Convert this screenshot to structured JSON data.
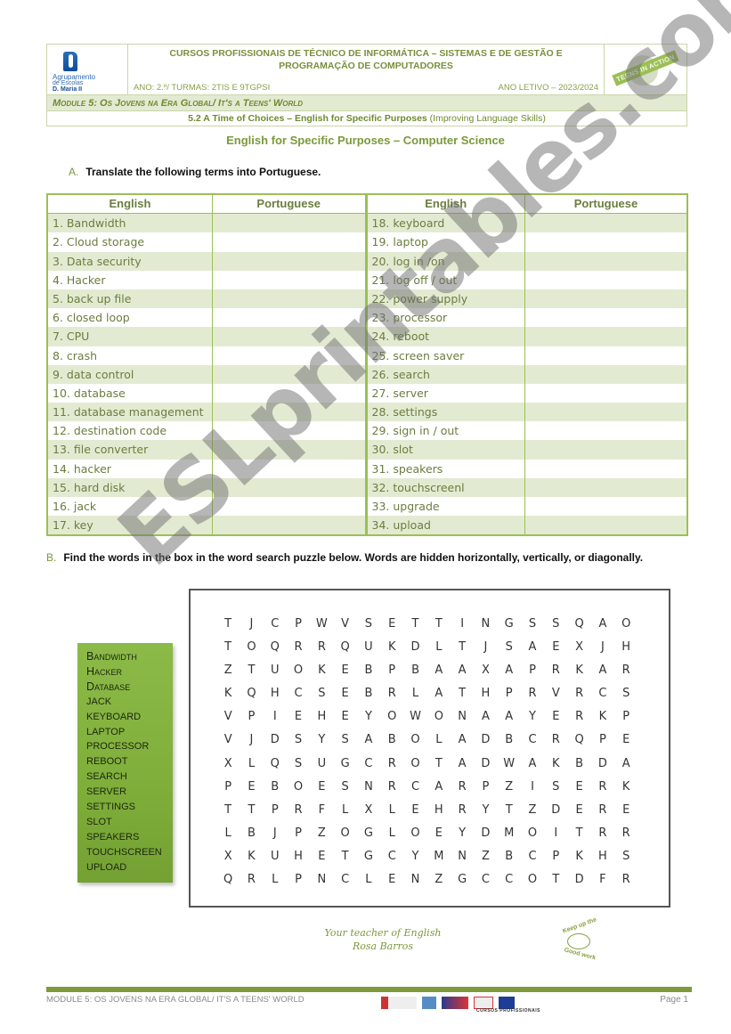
{
  "header": {
    "school_logo": {
      "line1": "Agrupamento",
      "line2": "de Escolas",
      "line3": "D. Maria II"
    },
    "course_title": "CURSOS PROFISSIONAIS DE TÉCNICO DE INFORMÁTICA – SISTEMAS E DE GESTÃO E PROGRAMAÇÃO DE COMPUTADORES",
    "year_classes": "ANO: 2.º/ TURMAS: 2TIS E 9TGPSI",
    "school_year": "ANO LETIVO – 2023/2024",
    "badge_text": "TEENS IN ACTION",
    "module": "Module 5: Os Jovens na Era Global/ It's a Teens' World",
    "subtitle_bold": "5.2 A Time of Choices – English for Specific Purposes",
    "subtitle_rest": " (Improving Language Skills)"
  },
  "doc_title": "English for Specific Purposes – Computer Science",
  "section_a": {
    "letter": "A.",
    "instruction": "Translate the following terms into Portuguese.",
    "columns": [
      "English",
      "Portuguese",
      "English",
      "Portuguese"
    ],
    "left_terms": [
      "1. Bandwidth",
      "2. Cloud storage",
      "3. Data security",
      "4. Hacker",
      "5. back up file",
      "6. closed loop",
      "7. CPU",
      "8. crash",
      "9. data control",
      "10. database",
      "11. database management",
      "12. destination code",
      "13. file converter",
      "14. hacker",
      "15. hard disk",
      "16. jack",
      "17. key"
    ],
    "right_terms": [
      "18. keyboard",
      "19. laptop",
      "20. log in /on",
      "21. log off / out",
      "22. power supply",
      "23. processor",
      "24. reboot",
      "25. screen saver",
      "26. search",
      "27. server",
      "28. settings",
      "29. sign in / out",
      "30. slot",
      "31. speakers",
      "32. touchscreenl",
      "33. upgrade",
      "34. upload"
    ]
  },
  "section_b": {
    "letter": "B.",
    "instruction": "Find the words in the box in the word search puzzle below. Words are hidden horizontally, vertically, or diagonally.",
    "word_list": [
      "Bandwidth",
      "Hacker",
      "Database",
      "JACK",
      "KEYBOARD",
      "LAPTOP",
      "PROCESSOR",
      "REBOOT",
      "SEARCH",
      "SERVER",
      "SETTINGS",
      "SLOT",
      "SPEAKERS",
      "TOUCHSCREEN",
      "UPLOAD"
    ],
    "grid": [
      "TJCPWVSETTINGSSQAO",
      "TOQRRQUKDLTJSAEXJH",
      "ZTUOKEBPBAAXAPRKAR",
      "KQHCSEBRLATHPRVRCS",
      "VPIEHEYOWONAAYERKP",
      "VJDSYSABOLADBCRQPE",
      "XLQSUGCROTADWAKBDA",
      "PEBOESNRCARPZISERK",
      "TTPRFLXLEHRYTZDERE",
      "LBJPZOGLOEYDMOITRR",
      "XKUHETGCYMNZBCPKHS",
      "QRLPNCLENZGCCOTDFR"
    ]
  },
  "signature": {
    "line1": "Your teacher of English",
    "line2": "Rosa Barros"
  },
  "stamp": {
    "top": "Keep up the",
    "bottom": "Good work"
  },
  "footer": {
    "module_text": "MODULE 5: OS JOVENS NA ERA GLOBAL/ IT'S A TEENS' WORLD",
    "page": "Page 1",
    "logos_caption": "CURSOS PROFISSIONAIS"
  },
  "watermark": "ESLprintables.com",
  "colors": {
    "accent_green": "#7b9a3a",
    "table_border": "#9cbf55",
    "row_stripe": "#e3ead2",
    "wordbox_green": "#7fae3a"
  }
}
